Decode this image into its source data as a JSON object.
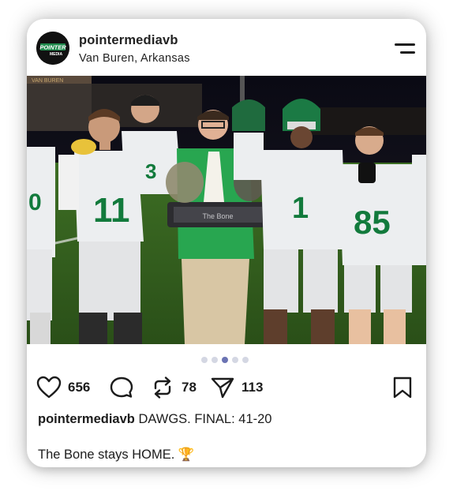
{
  "post": {
    "author": "pointermediavb",
    "location": "Van Buren, Arkansas",
    "avatar_text": "POINTER MEDIA",
    "image": {
      "jerseys": [
        "11",
        "1",
        "85"
      ],
      "trophy_text": "The Bone",
      "stadium_text": "VAN BUREN"
    },
    "carousel": {
      "count": 5,
      "active_index": 3
    },
    "actions": {
      "likes": "656",
      "reposts": "78",
      "shares": "113"
    },
    "caption_user": "pointermediavb",
    "caption_text": "DAWGS. FINAL: 41-20",
    "caption_line2": "The Bone stays HOME.",
    "caption_emoji": "🏆"
  },
  "colors": {
    "team_green": "#127a3c",
    "dot_active": "#6b73b3",
    "dot_inactive": "#d4d7e3",
    "text": "#1c1c1c"
  },
  "icons": [
    "menu-icon",
    "heart-icon",
    "comment-icon",
    "repost-icon",
    "share-icon",
    "bookmark-icon",
    "trophy-emoji"
  ]
}
